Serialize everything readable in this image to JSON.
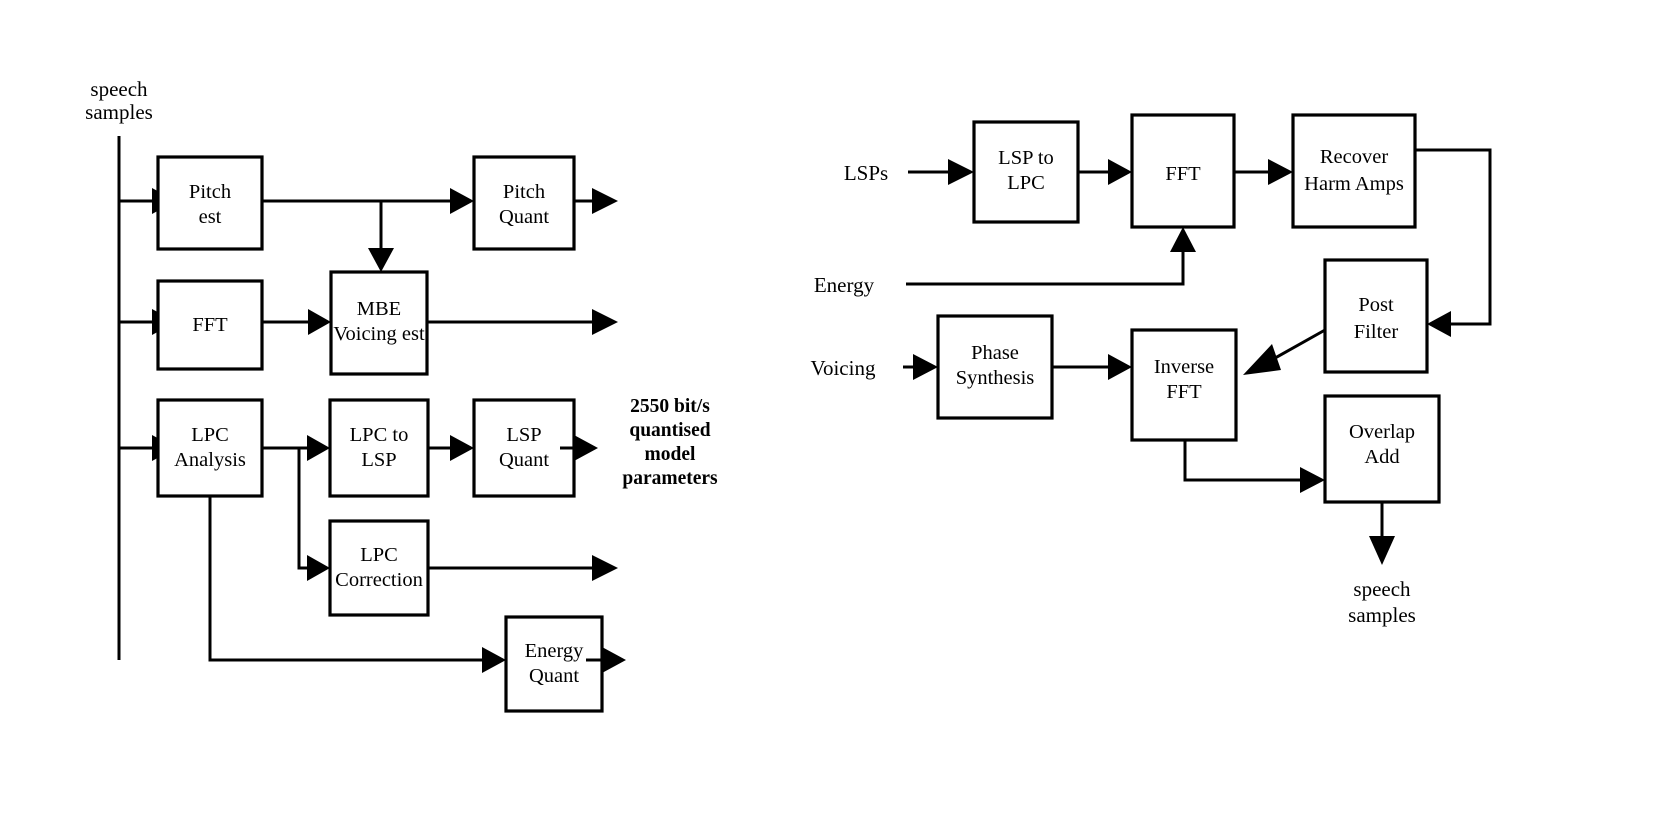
{
  "figure": {
    "kind": "block-diagram",
    "title_visible": false,
    "stroke_color": "#000000",
    "fill_color": "#ffffff",
    "background": "#ffffff"
  },
  "encoder": {
    "name": "encoder-diagram",
    "inputs": [
      {
        "id": "speech-in",
        "label_line1": "speech",
        "label_line2": "samples"
      }
    ],
    "outputs": [
      {
        "id": "bitstream",
        "line1": "2550 bit/s",
        "line2": "quantised",
        "line3": "model",
        "line4": "parameters"
      }
    ],
    "blocks": [
      {
        "id": "pitch-est",
        "line1": "Pitch",
        "line2": "est"
      },
      {
        "id": "pitch-quant",
        "line1": "Pitch",
        "line2": "Quant"
      },
      {
        "id": "fft",
        "line1": "FFT",
        "line2": ""
      },
      {
        "id": "mbe-voicing-est",
        "line1": "MBE",
        "line2": "Voicing est"
      },
      {
        "id": "lpc-analysis",
        "line1": "LPC",
        "line2": "Analysis"
      },
      {
        "id": "lpc-to-lsp",
        "line1": "LPC to",
        "line2": "LSP"
      },
      {
        "id": "lsp-quant",
        "line1": "LSP",
        "line2": "Quant"
      },
      {
        "id": "lpc-correction",
        "line1": "LPC",
        "line2": "Correction"
      },
      {
        "id": "energy-quant",
        "line1": "Energy",
        "line2": "Quant"
      }
    ],
    "connections": [
      {
        "from": "speech-in",
        "to": "pitch-est"
      },
      {
        "from": "speech-in",
        "to": "fft"
      },
      {
        "from": "speech-in",
        "to": "lpc-analysis"
      },
      {
        "from": "pitch-est",
        "to": "pitch-quant"
      },
      {
        "from": "pitch-est",
        "to": "mbe-voicing-est"
      },
      {
        "from": "fft",
        "to": "mbe-voicing-est"
      },
      {
        "from": "mbe-voicing-est",
        "to": "bitstream"
      },
      {
        "from": "pitch-quant",
        "to": "bitstream"
      },
      {
        "from": "lpc-analysis",
        "to": "lpc-to-lsp"
      },
      {
        "from": "lpc-analysis",
        "to": "lpc-correction"
      },
      {
        "from": "lpc-analysis",
        "to": "energy-quant"
      },
      {
        "from": "lpc-to-lsp",
        "to": "lsp-quant"
      },
      {
        "from": "lsp-quant",
        "to": "bitstream"
      },
      {
        "from": "lpc-correction",
        "to": "bitstream"
      },
      {
        "from": "energy-quant",
        "to": "bitstream"
      }
    ]
  },
  "decoder": {
    "name": "decoder-diagram",
    "inputs": [
      {
        "id": "lsps-in",
        "label": "LSPs"
      },
      {
        "id": "energy-in",
        "label": "Energy"
      },
      {
        "id": "voicing-in",
        "label": "Voicing"
      }
    ],
    "outputs": [
      {
        "id": "speech-out",
        "label_line1": "speech",
        "label_line2": "samples"
      }
    ],
    "blocks": [
      {
        "id": "lsp-to-lpc",
        "line1": "LSP to",
        "line2": "LPC"
      },
      {
        "id": "fft-dec",
        "line1": "FFT",
        "line2": ""
      },
      {
        "id": "recover-harm-amps",
        "line1": "Recover",
        "line2": "Harm Amps"
      },
      {
        "id": "post-filter",
        "line1": "Post",
        "line2": "Filter"
      },
      {
        "id": "phase-synthesis",
        "line1": "Phase",
        "line2": "Synthesis"
      },
      {
        "id": "inverse-fft",
        "line1": "Inverse",
        "line2": "FFT"
      },
      {
        "id": "overlap-add",
        "line1": "Overlap",
        "line2": "Add"
      }
    ],
    "connections": [
      {
        "from": "lsps-in",
        "to": "lsp-to-lpc"
      },
      {
        "from": "lsp-to-lpc",
        "to": "fft-dec"
      },
      {
        "from": "energy-in",
        "to": "fft-dec"
      },
      {
        "from": "fft-dec",
        "to": "recover-harm-amps"
      },
      {
        "from": "recover-harm-amps",
        "to": "post-filter"
      },
      {
        "from": "post-filter",
        "to": "inverse-fft"
      },
      {
        "from": "voicing-in",
        "to": "phase-synthesis"
      },
      {
        "from": "phase-synthesis",
        "to": "inverse-fft"
      },
      {
        "from": "inverse-fft",
        "to": "overlap-add"
      },
      {
        "from": "overlap-add",
        "to": "speech-out"
      }
    ]
  }
}
